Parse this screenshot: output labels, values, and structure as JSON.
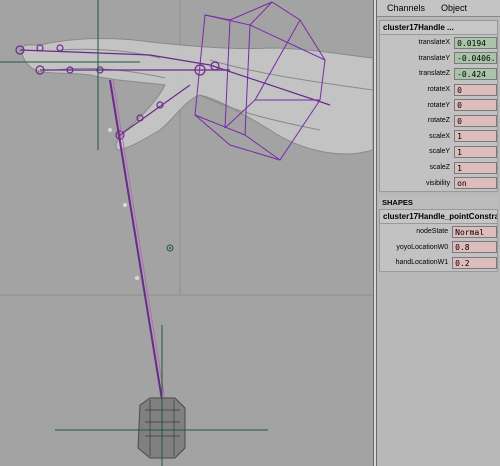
{
  "menu": {
    "channels": "Channels",
    "object": "Object"
  },
  "channel_box": {
    "node_name": "cluster17Handle ...",
    "attributes": [
      {
        "label": "translateX",
        "value": "0.0194",
        "state": "green"
      },
      {
        "label": "translateY",
        "value": "-0.0406.",
        "state": "green"
      },
      {
        "label": "translateZ",
        "value": "-0.424",
        "state": "green"
      },
      {
        "label": "rotateX",
        "value": "0",
        "state": "pink"
      },
      {
        "label": "rotateY",
        "value": "0",
        "state": "pink"
      },
      {
        "label": "rotateZ",
        "value": "0",
        "state": "pink"
      },
      {
        "label": "scaleX",
        "value": "1",
        "state": "pink"
      },
      {
        "label": "scaleY",
        "value": "1",
        "state": "pink"
      },
      {
        "label": "scaleZ",
        "value": "1",
        "state": "pink"
      },
      {
        "label": "visibility",
        "value": "on",
        "state": "pink"
      }
    ]
  },
  "shapes": {
    "header": "SHAPES",
    "node_name": "cluster17Handle_pointConstra...",
    "attributes": [
      {
        "label": "nodeState",
        "value": "Normal",
        "state": "pink"
      },
      {
        "label": "yoyoLocationW0",
        "value": "0.8",
        "state": "white"
      },
      {
        "label": "handLocationW1",
        "value": "0.2",
        "state": "white"
      }
    ]
  },
  "colors": {
    "viewport_bg": "#a3a3a3",
    "wire_purple": "#6a2a8a",
    "wire_pink": "#b070b0",
    "axis_green": "#1f5a3a",
    "value_green": "#a9c4a9",
    "value_pink": "#ddbcbc"
  }
}
